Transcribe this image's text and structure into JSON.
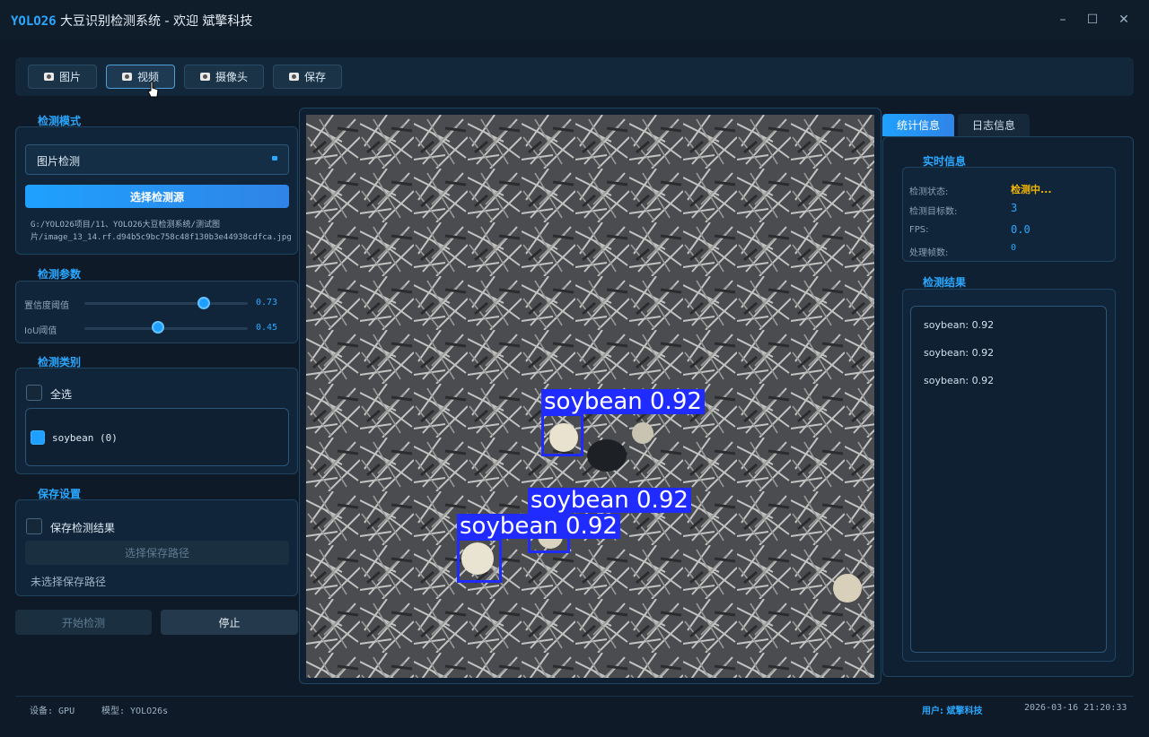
{
  "window": {
    "brand": "YOLO26",
    "title": "大豆识别检测系统 - 欢迎 斌擎科技",
    "min_icon": "minimize-icon",
    "max_icon": "maximize-icon",
    "close_icon": "close-icon"
  },
  "toolbar": {
    "image_label": "图片",
    "video_label": "视频",
    "camera_label": "摄像头",
    "save_label": "保存"
  },
  "mode": {
    "section_title": "检测模式",
    "selected": "图片检测",
    "select_source": "选择检测源",
    "path": "G:/YOLO26项目/11、YOLO26大豆检测系统/测试图片/image_13_14.rf.d94b5c9bc758c48f130b3e44938cdfca.jpg"
  },
  "params": {
    "section_title": "检测参数",
    "conf_label": "置信度阈值",
    "conf_value": "0.73",
    "conf_level": 0.73,
    "iou_label": "IoU阈值",
    "iou_value": "0.45",
    "iou_level": 0.45
  },
  "classes": {
    "section_title": "检测类别",
    "select_all": "全选",
    "items": [
      {
        "label": "soybean (0)",
        "checked": true
      }
    ]
  },
  "save": {
    "section_title": "保存设置",
    "save_results": "保存检测结果",
    "choose_path": "选择保存路径",
    "no_path": "未选择保存路径"
  },
  "actions": {
    "start": "开始检测",
    "stop": "停止"
  },
  "detections": [
    {
      "label": "soybean 0.92"
    },
    {
      "label": "soybean 0.92"
    },
    {
      "label": "soybean 0.92"
    }
  ],
  "right": {
    "tabs": [
      "统计信息",
      "日志信息"
    ],
    "realtime_title": "实时信息",
    "status_label": "检测状态:",
    "status_value": "检测中...",
    "count_label": "检测目标数:",
    "count_value": "3",
    "fps_label": "FPS:",
    "fps_value": "0.0",
    "frames_label": "处理帧数:",
    "frames_value": "0",
    "results_title": "检测结果",
    "results": [
      "soybean: 0.92",
      "soybean: 0.92",
      "soybean: 0.92"
    ]
  },
  "statusbar": {
    "device": "设备: GPU",
    "model": "模型: YOLO26s",
    "user": "用户: 斌擎科技",
    "datetime": "2026-03-16 21:20:33"
  },
  "colors": {
    "accent": "#2aa8ff",
    "warning": "#f5b800",
    "bbox": "#1f2bff"
  }
}
